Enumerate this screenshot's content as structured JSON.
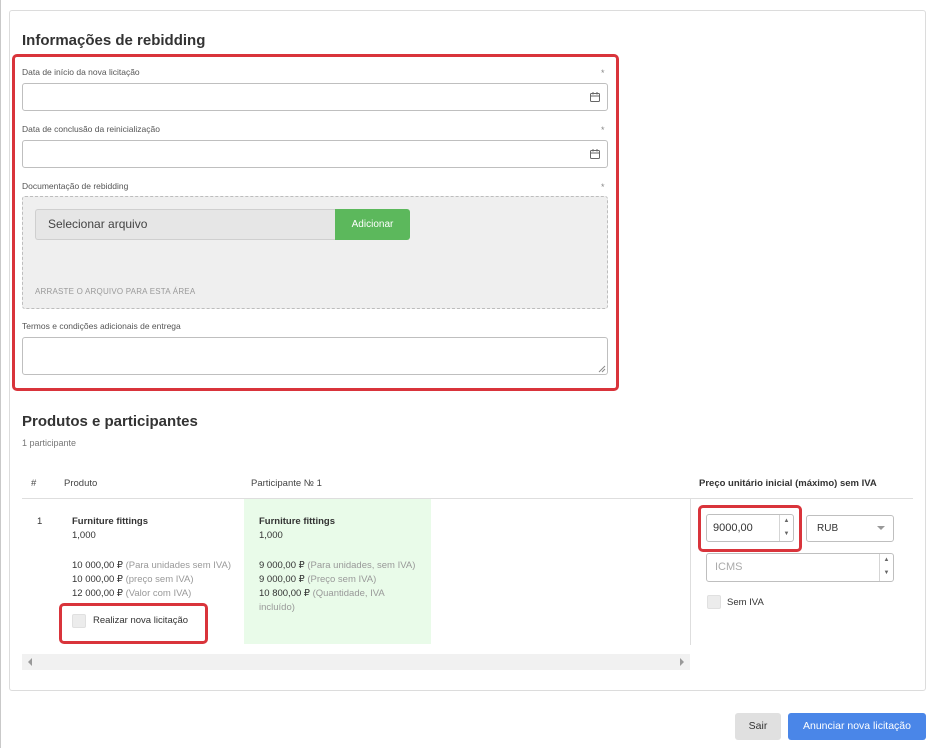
{
  "rebidding": {
    "title": "Informações de rebidding",
    "start_date_label": "Data de início da nova licitação",
    "end_date_label": "Data de conclusão da reinicialização",
    "docs_label": "Documentação de rebidding",
    "select_file_label": "Selecionar arquivo",
    "add_label": "Adicionar",
    "drop_hint": "ARRASTE O ARQUIVO PARA ESTA ÁREA",
    "terms_label": "Termos e condições adicionais de entrega",
    "required_mark": "*"
  },
  "products": {
    "title": "Produtos e participantes",
    "participants_count": "1 participante",
    "columns": {
      "index": "#",
      "product": "Produto",
      "participant": "Participante № 1",
      "initial_price": "Preço unitário inicial (máximo) sem IVA"
    },
    "row": {
      "index": "1",
      "product_name": "Furniture fittings",
      "product_qty": "1,000",
      "product_price_units_value": "10 000,00 ₽",
      "product_price_units_note": "(Para unidades sem IVA)",
      "product_price_novat_value": "10 000,00 ₽",
      "product_price_novat_note": "(preço sem IVA)",
      "product_price_vat_value": "12 000,00 ₽",
      "product_price_vat_note": "(Valor com IVA)",
      "rebid_checkbox_label": "Realizar nova licitação",
      "participant_name": "Furniture fittings",
      "participant_qty": "1,000",
      "participant_price_units_value": "9 000,00 ₽",
      "participant_price_units_note": "(Para unidades, sem IVA)",
      "participant_price_novat_value": "9 000,00 ₽",
      "participant_price_novat_note": "(Preço sem IVA)",
      "participant_price_vat_value": "10 800,00 ₽",
      "participant_price_vat_note_1": "(Quantidade, IVA",
      "participant_price_vat_note_2": "incluído)"
    },
    "price_input_value": "9000,00",
    "currency": "RUB",
    "icms_placeholder": "ICMS",
    "no_vat_label": "Sem IVA"
  },
  "footer": {
    "exit_label": "Sair",
    "announce_label": "Anunciar nova licitação"
  },
  "colors": {
    "highlight": "#d9343b",
    "add_button": "#5cb85c",
    "announce_button": "#4a86e8",
    "participant_column": "#e9fbe9"
  },
  "icons": [
    "calendar-icon",
    "resize-grip-icon",
    "spinner-up-icon",
    "spinner-down-icon",
    "caret-down-icon",
    "scroll-left-icon",
    "scroll-right-icon"
  ]
}
